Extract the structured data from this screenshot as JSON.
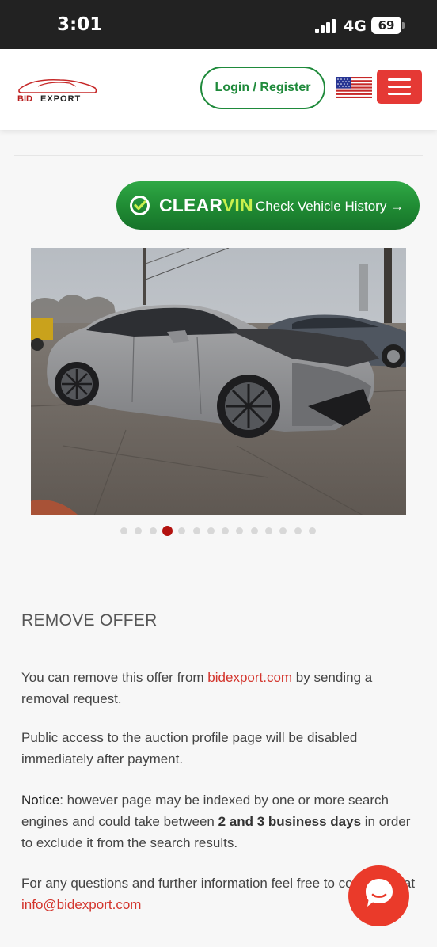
{
  "status_bar": {
    "time": "3:01",
    "network": "4G",
    "battery": "69"
  },
  "header": {
    "logo_text": "BID EXPORT",
    "login_label": "Login / Register",
    "flag_icon": "us-flag-icon",
    "menu_icon": "hamburger-menu-icon"
  },
  "clearvin": {
    "brand_clear": "CLEAR",
    "brand_vin": "VIN",
    "label": "Check Vehicle History",
    "arrow": "→"
  },
  "gallery": {
    "dot_count": 14,
    "active_index": 3
  },
  "remove_offer": {
    "heading": "REMOVE OFFER",
    "p1_before": "You can remove this offer from ",
    "p1_link": "bidexport.com",
    "p1_after": " by sending a removal request.",
    "p2": "Public access to the auction profile page will be disabled immediately after payment.",
    "p3_notice": "Notice",
    "p3_a": ": however page may be indexed by one or more search engines and could take between ",
    "p3_bold": "2 and 3 business days",
    "p3_b": " in order to exclude it from the search results.",
    "p4_before": "For any questions and further information feel free to contact us at ",
    "p4_email": "info@bidexport.com"
  },
  "colors": {
    "brand_red": "#e53935",
    "brand_green": "#1f8a3b",
    "link_red": "#d3342c"
  }
}
